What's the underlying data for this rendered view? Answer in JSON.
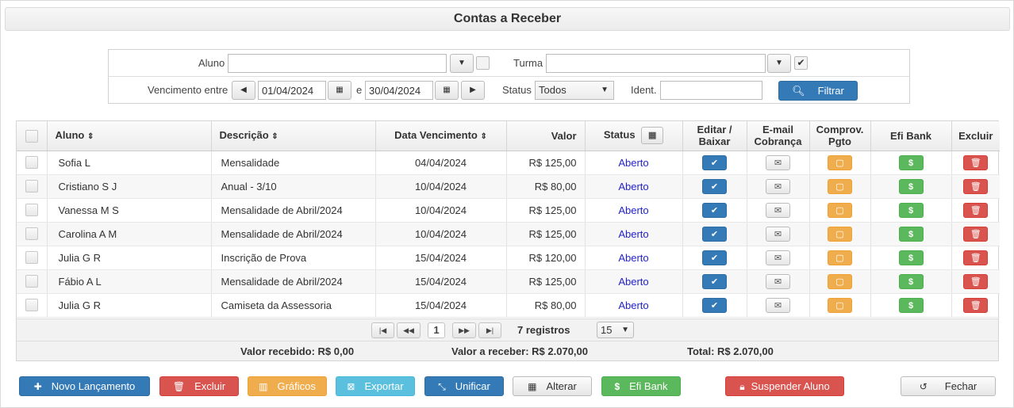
{
  "title": "Contas a Receber",
  "filters": {
    "aluno_label": "Aluno",
    "aluno_value": "",
    "turma_label": "Turma",
    "turma_value": "",
    "vencimento_label": "Vencimento entre",
    "date_from": "01/04/2024",
    "date_sep": "e",
    "date_to": "30/04/2024",
    "status_label": "Status",
    "status_value": "Todos",
    "ident_label": "Ident.",
    "ident_value": "",
    "filtrar_label": "Filtrar"
  },
  "table": {
    "headers": {
      "aluno": "Aluno",
      "descricao": "Descrição",
      "vencimento": "Data Vencimento",
      "valor": "Valor",
      "status": "Status",
      "editar": "Editar /\nBaixar",
      "email": "E-mail\nCobrança",
      "comprov": "Comprov.\nPgto",
      "efi": "Efi Bank",
      "excluir": "Excluir"
    },
    "rows": [
      {
        "aluno": "Sofia L",
        "descricao": "Mensalidade",
        "vencimento": "04/04/2024",
        "valor": "R$ 125,00",
        "status": "Aberto"
      },
      {
        "aluno": "Cristiano S J",
        "descricao": "Anual - 3/10",
        "vencimento": "10/04/2024",
        "valor": "R$ 80,00",
        "status": "Aberto"
      },
      {
        "aluno": "Vanessa M S",
        "descricao": "Mensalidade de Abril/2024",
        "vencimento": "10/04/2024",
        "valor": "R$ 125,00",
        "status": "Aberto"
      },
      {
        "aluno": "Carolina A M",
        "descricao": "Mensalidade de Abril/2024",
        "vencimento": "10/04/2024",
        "valor": "R$ 125,00",
        "status": "Aberto"
      },
      {
        "aluno": "Julia G R",
        "descricao": "Inscrição de Prova",
        "vencimento": "15/04/2024",
        "valor": "R$ 120,00",
        "status": "Aberto"
      },
      {
        "aluno": "Fábio A L",
        "descricao": "Mensalidade de Abril/2024",
        "vencimento": "15/04/2024",
        "valor": "R$ 125,00",
        "status": "Aberto"
      },
      {
        "aluno": "Julia G R",
        "descricao": "Camiseta da Assessoria",
        "vencimento": "15/04/2024",
        "valor": "R$ 80,00",
        "status": "Aberto"
      }
    ]
  },
  "pager": {
    "current_page": "1",
    "records": "7 registros",
    "page_size": "15"
  },
  "totals": {
    "recebido": "Valor recebido: R$ 0,00",
    "a_receber": "Valor a receber: R$ 2.070,00",
    "total": "Total: R$ 2.070,00"
  },
  "toolbar": {
    "novo": "Novo Lançamento",
    "excluir": "Excluir",
    "graficos": "Gráficos",
    "exportar": "Exportar",
    "unificar": "Unificar",
    "alterar": "Alterar",
    "efi": "Efi Bank",
    "suspender": "Suspender Aluno",
    "fechar": "Fechar"
  },
  "colors": {
    "primary": "#337ab7",
    "danger": "#d9534f",
    "warning": "#f0ad4e",
    "info": "#5bc0de",
    "success": "#5cb85c",
    "status_text": "#2222cc"
  }
}
